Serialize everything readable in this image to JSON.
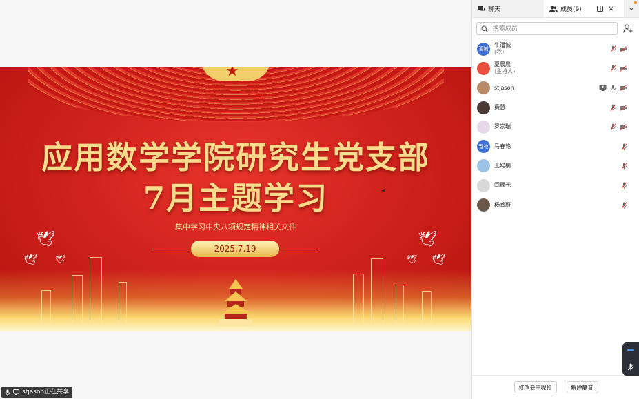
{
  "shared_screen": {
    "title_line1": "应用数学学院研究生党支部",
    "title_line2": "7月主题学习",
    "subtitle": "集中学习中央八项规定精神相关文件",
    "date": "2025.7.19"
  },
  "share_status": {
    "text": "stjason正在共享",
    "icons": [
      "microphone-icon",
      "screen-share-icon"
    ]
  },
  "panel": {
    "tabs": [
      {
        "label": "聊天",
        "icon": "chat-icon"
      },
      {
        "label": "成员(9)",
        "icon": "members-icon"
      }
    ],
    "search_placeholder": "搜索成员",
    "members": [
      {
        "name": "牛潘铖",
        "role": "(我)",
        "avatar_text": "潘铖",
        "avatar_color": "#3f6fd3",
        "icons": [
          "mic-muted-icon",
          "camera-off-icon"
        ]
      },
      {
        "name": "夏晨晨",
        "role": "(主持人)",
        "avatar_text": "",
        "avatar_color": "#e7503d",
        "icons": [
          "mic-muted-icon",
          "camera-off-icon"
        ]
      },
      {
        "name": "stjason",
        "role": "",
        "avatar_text": "",
        "avatar_color": "#b88a6a",
        "icons": [
          "screen-share-icon",
          "mic-on-icon",
          "camera-off-icon"
        ]
      },
      {
        "name": "费慧",
        "role": "",
        "avatar_text": "",
        "avatar_color": "#4a3a34",
        "icons": [
          "mic-muted-icon",
          "camera-off-icon"
        ]
      },
      {
        "name": "罗崇瑞",
        "role": "",
        "avatar_text": "",
        "avatar_color": "#e6d8e8",
        "icons": [
          "mic-muted-icon",
          "camera-off-icon"
        ]
      },
      {
        "name": "马春艳",
        "role": "",
        "avatar_text": "春艳",
        "avatar_color": "#3f6fd3",
        "icons": [
          "mic-muted-icon"
        ]
      },
      {
        "name": "王婼楠",
        "role": "",
        "avatar_text": "",
        "avatar_color": "#9cc2e6",
        "icons": [
          "mic-muted-icon"
        ]
      },
      {
        "name": "闫辰光",
        "role": "",
        "avatar_text": "",
        "avatar_color": "#d8d8d8",
        "icons": [
          "mic-muted-icon"
        ]
      },
      {
        "name": "杨香蔚",
        "role": "",
        "avatar_text": "",
        "avatar_color": "#6b5a4b",
        "icons": [
          "mic-muted-icon"
        ]
      }
    ],
    "footer": {
      "rename_label": "修改会中昵称",
      "unmute_label": "解除静音"
    }
  },
  "colors": {
    "accent_blue": "#3f6fd3",
    "slide_red": "#d1231d",
    "slide_gold": "#f8dc8e"
  }
}
